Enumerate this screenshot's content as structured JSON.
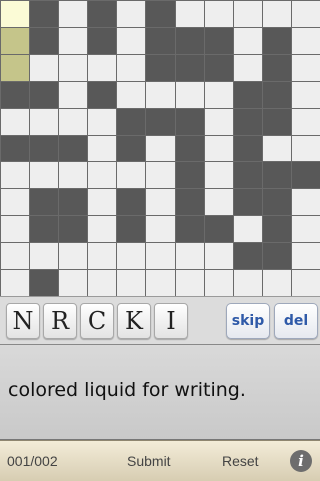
{
  "puzzle": {
    "rows": 11,
    "cols": 11,
    "grid": [
      "WBWBWBWWWWW",
      "WBWBWBBBWBW",
      "WWWWWBBBWBW",
      "BBWBWWWWBBW",
      "WWWWBBBWBBW",
      "BBBWBWBWBWW",
      "WWWWWWBWBBB",
      "WBBWBWBWBBW",
      "WBBWBWBBWBW",
      "WWWWWWWWBBW",
      "WBWWWWWWWWW"
    ],
    "current_cell": [
      0,
      0
    ],
    "selected_cells": [
      [
        1,
        0
      ],
      [
        2,
        0
      ]
    ]
  },
  "keyboard": {
    "letters": [
      "N",
      "R",
      "C",
      "K",
      "I"
    ],
    "skip_label": "skip",
    "del_label": "del"
  },
  "clue": {
    "text": "colored liquid for writing."
  },
  "bottom_bar": {
    "progress": "001/002",
    "submit_label": "Submit",
    "reset_label": "Reset",
    "info_icon": "i"
  }
}
